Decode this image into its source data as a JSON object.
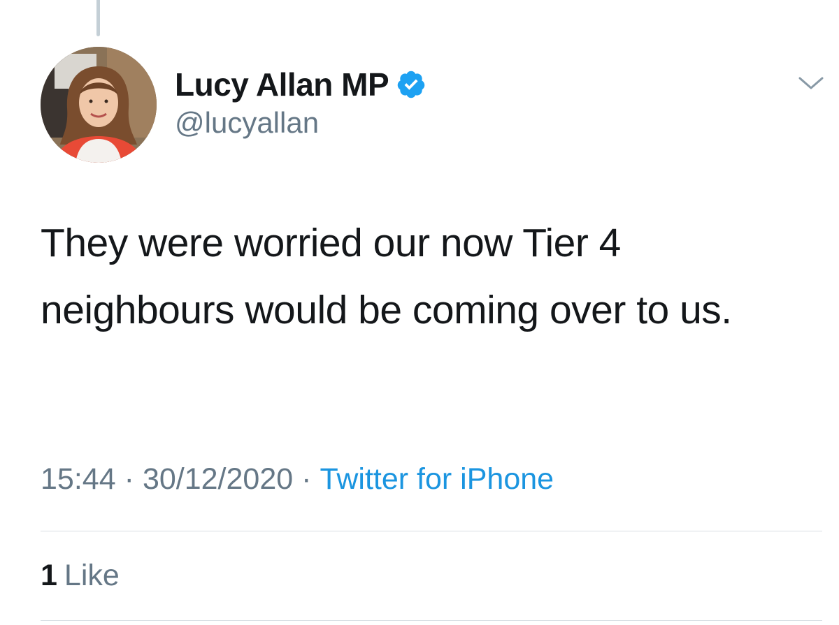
{
  "tweet": {
    "author": {
      "display_name": "Lucy Allan MP",
      "handle": "@lucyallan",
      "verified": true
    },
    "text": "They were worried our now Tier 4 neighbours would be coming over to us.",
    "time": "15:44",
    "date": "30/12/2020",
    "separator": "·",
    "source": "Twitter for iPhone",
    "likes": {
      "count": "1",
      "label": "Like"
    }
  },
  "colors": {
    "text": "#14171a",
    "muted": "#657786",
    "link": "#1b95e0",
    "verified": "#1da1f2",
    "divider": "#d8dee3"
  },
  "icons": {
    "verified": "verified-badge-icon",
    "menu": "chevron-down-icon"
  }
}
